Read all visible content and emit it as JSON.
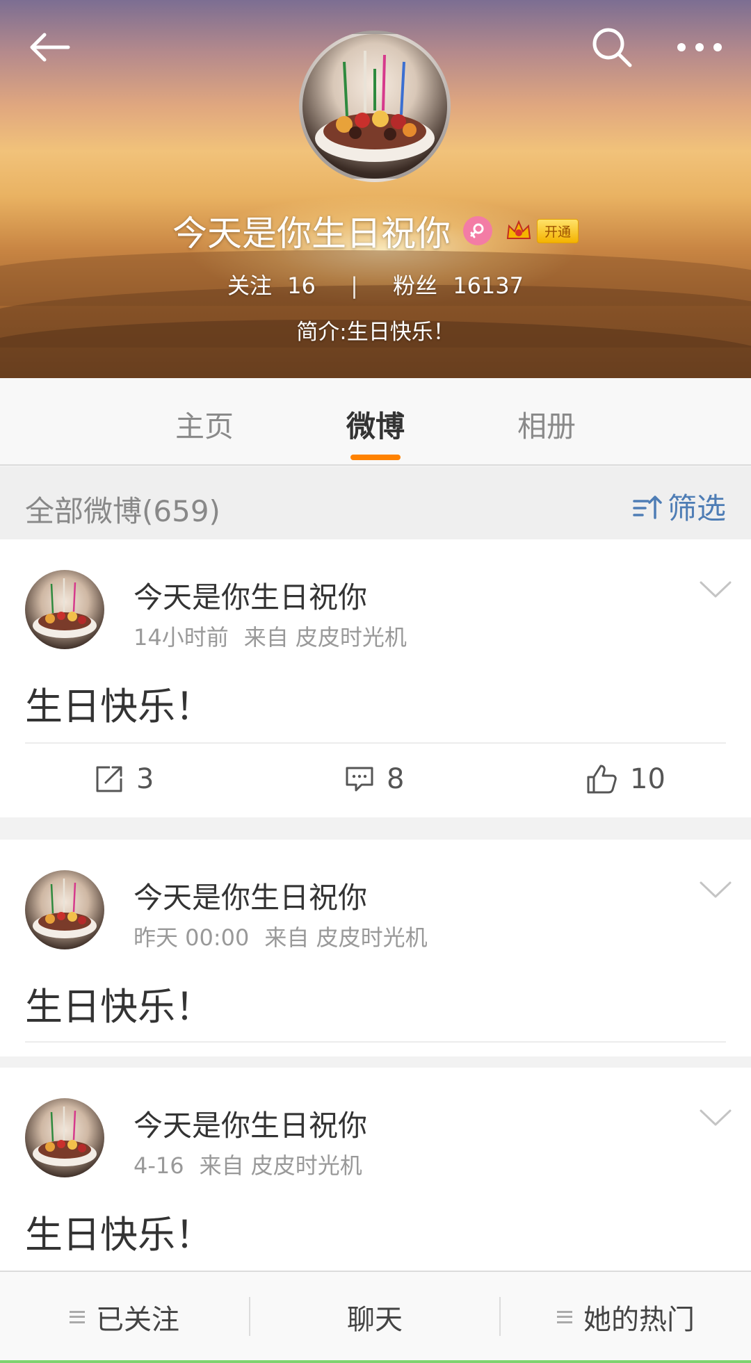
{
  "header": {
    "name": "今天是你生日祝你",
    "vip_label": "开通",
    "following_label": "关注",
    "following_count": "16",
    "separator": "|",
    "followers_label": "粉丝",
    "followers_count": "16137",
    "intro": "简介:生日快乐！"
  },
  "tabs": [
    {
      "label": "主页"
    },
    {
      "label": "微博",
      "active": true
    },
    {
      "label": "相册"
    }
  ],
  "filter": {
    "title": "全部微博(659)",
    "button_label": "筛选"
  },
  "posts": [
    {
      "author": "今天是你生日祝你",
      "time": "14小时前",
      "source": "来自 皮皮时光机",
      "text": "生日快乐！",
      "reposts": "3",
      "comments": "8",
      "likes": "10"
    },
    {
      "author": "今天是你生日祝你",
      "time": "昨天 00:00",
      "source": "来自 皮皮时光机",
      "text": "生日快乐！"
    },
    {
      "author": "今天是你生日祝你",
      "time": "4-16",
      "source": "来自 皮皮时光机",
      "text": "生日快乐！"
    }
  ],
  "bottom_bar": {
    "followed": "已关注",
    "chat": "聊天",
    "hot": "她的热门"
  },
  "colors": {
    "accent": "#ff8200",
    "link": "#4e7db5",
    "gender": "#f37ca5"
  }
}
